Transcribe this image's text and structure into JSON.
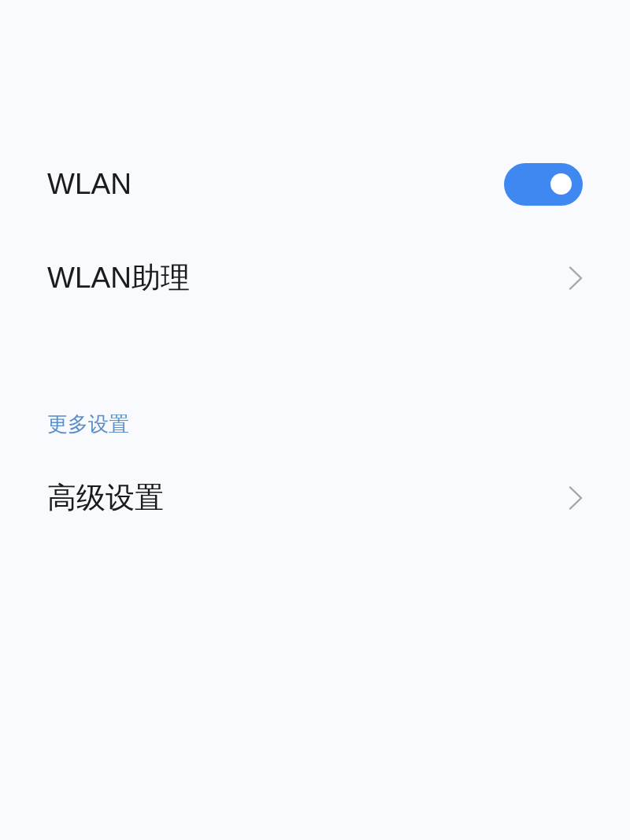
{
  "sections": [
    {
      "items": [
        {
          "kind": "toggle",
          "label": "WLAN",
          "on": true
        },
        {
          "kind": "link",
          "label": "WLAN助理"
        }
      ]
    },
    {
      "header": "更多设置",
      "items": [
        {
          "kind": "link",
          "label": "高级设置"
        }
      ]
    }
  ]
}
